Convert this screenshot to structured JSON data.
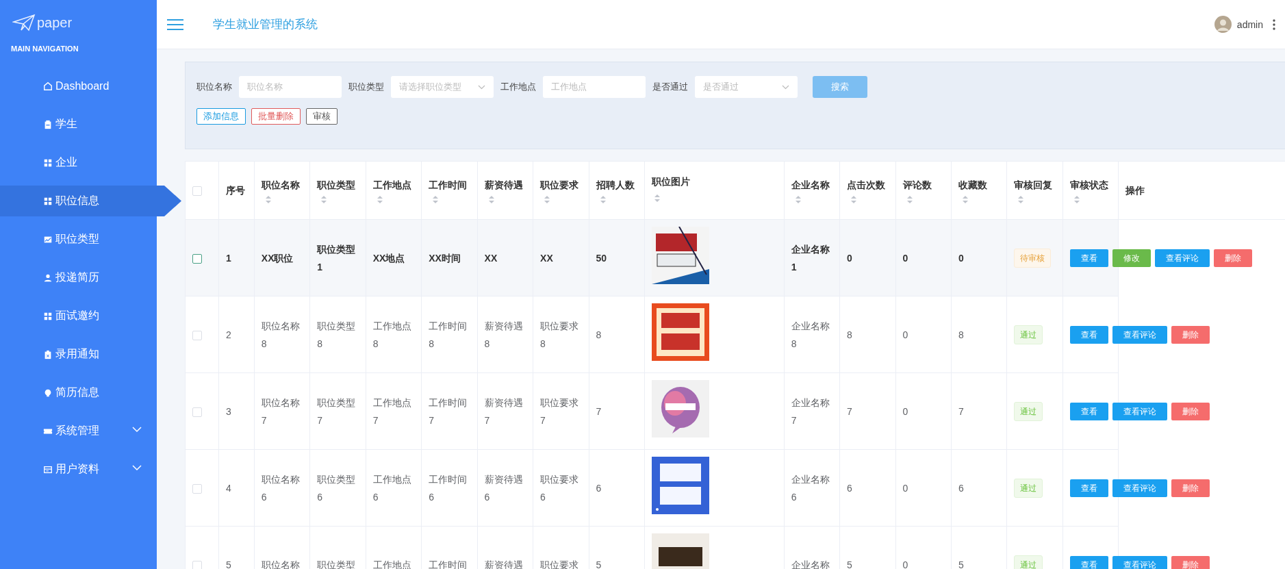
{
  "sidebar": {
    "logo": "paper",
    "section": "MAIN NAVIGATION",
    "items": [
      {
        "label": "Dashboard",
        "selected": false,
        "expandable": false
      },
      {
        "label": "学生",
        "selected": false,
        "expandable": false
      },
      {
        "label": "企业",
        "selected": false,
        "expandable": false
      },
      {
        "label": "职位信息",
        "selected": true,
        "expandable": false
      },
      {
        "label": "职位类型",
        "selected": false,
        "expandable": false
      },
      {
        "label": "投递简历",
        "selected": false,
        "expandable": false
      },
      {
        "label": "面试邀约",
        "selected": false,
        "expandable": false
      },
      {
        "label": "录用通知",
        "selected": false,
        "expandable": false
      },
      {
        "label": "简历信息",
        "selected": false,
        "expandable": false
      },
      {
        "label": "系统管理",
        "selected": false,
        "expandable": true
      },
      {
        "label": "用户资料",
        "selected": false,
        "expandable": true
      }
    ]
  },
  "header": {
    "title": "学生就业管理的系统",
    "user": "admin"
  },
  "filters": {
    "fields": [
      {
        "label": "职位名称",
        "placeholder": "职位名称",
        "kind": "input"
      },
      {
        "label": "职位类型",
        "placeholder": "请选择职位类型",
        "kind": "select"
      },
      {
        "label": "工作地点",
        "placeholder": "工作地点",
        "kind": "input"
      },
      {
        "label": "是否通过",
        "placeholder": "是否通过",
        "kind": "select"
      }
    ],
    "search": "搜索",
    "actions": [
      {
        "label": "添加信息",
        "kind": "add"
      },
      {
        "label": "批量删除",
        "kind": "delete"
      },
      {
        "label": "审核",
        "kind": "audit"
      }
    ]
  },
  "table": {
    "header_checkbox": {
      "checked": false
    },
    "columns": [
      {
        "label": "序号",
        "sortable": false
      },
      {
        "label": "职位名称",
        "sortable": true
      },
      {
        "label": "职位类型",
        "sortable": true
      },
      {
        "label": "工作地点",
        "sortable": true
      },
      {
        "label": "工作时间",
        "sortable": true
      },
      {
        "label": "薪资待遇",
        "sortable": true
      },
      {
        "label": "职位要求",
        "sortable": true
      },
      {
        "label": "招聘人数",
        "sortable": true
      },
      {
        "label": "职位图片",
        "sortable": true
      },
      {
        "label": "企业名称",
        "sortable": true
      },
      {
        "label": "点击次数",
        "sortable": true
      },
      {
        "label": "评论数",
        "sortable": true
      },
      {
        "label": "收藏数",
        "sortable": true
      },
      {
        "label": "审核回复",
        "sortable": true
      },
      {
        "label": "审核状态",
        "sortable": true
      },
      {
        "label": "操作",
        "sortable": false
      }
    ],
    "rows": [
      {
        "checked": false,
        "highlighted": true,
        "cells": [
          "1",
          "XX职位",
          "职位类型1",
          "XX地点",
          "XX时间",
          "XX",
          "XX",
          "50"
        ],
        "image": {
          "kind": "picture"
        },
        "cells2": [
          "企业名称1",
          "0",
          "0",
          "0"
        ],
        "status": {
          "text": "待审核",
          "kind": "pending"
        },
        "buttons": [
          {
            "label": "查看",
            "kind": "view"
          },
          {
            "label": "修改",
            "kind": "edit"
          },
          {
            "label": "查看评论",
            "kind": "view"
          },
          {
            "label": "删除",
            "kind": "delete"
          }
        ]
      },
      {
        "checked": false,
        "highlighted": false,
        "cells": [
          "2",
          "职位名称8",
          "职位类型8",
          "工作地点8",
          "工作时间8",
          "薪资待遇8",
          "职位要求8",
          "8"
        ],
        "image": {
          "kind": "picture"
        },
        "cells2": [
          "企业名称8",
          "8",
          "0",
          "8"
        ],
        "status": {
          "text": "通过",
          "kind": "passed"
        },
        "buttons": [
          {
            "label": "查看",
            "kind": "view"
          },
          {
            "label": "查看评论",
            "kind": "view"
          },
          {
            "label": "删除",
            "kind": "delete"
          }
        ]
      },
      {
        "checked": false,
        "highlighted": false,
        "cells": [
          "3",
          "职位名称7",
          "职位类型7",
          "工作地点7",
          "工作时间7",
          "薪资待遇7",
          "职位要求7",
          "7"
        ],
        "image": {
          "kind": "picture"
        },
        "cells2": [
          "企业名称7",
          "7",
          "0",
          "7"
        ],
        "status": {
          "text": "通过",
          "kind": "passed"
        },
        "buttons": [
          {
            "label": "查看",
            "kind": "view"
          },
          {
            "label": "查看评论",
            "kind": "view"
          },
          {
            "label": "删除",
            "kind": "delete"
          }
        ]
      },
      {
        "checked": false,
        "highlighted": false,
        "cells": [
          "4",
          "职位名称6",
          "职位类型6",
          "工作地点6",
          "工作时间6",
          "薪资待遇6",
          "职位要求6",
          "6"
        ],
        "image": {
          "kind": "picture"
        },
        "cells2": [
          "企业名称6",
          "6",
          "0",
          "6"
        ],
        "status": {
          "text": "通过",
          "kind": "passed"
        },
        "buttons": [
          {
            "label": "查看",
            "kind": "view"
          },
          {
            "label": "查看评论",
            "kind": "view"
          },
          {
            "label": "删除",
            "kind": "delete"
          }
        ]
      },
      {
        "checked": false,
        "highlighted": false,
        "cells": [
          "5",
          "职位名称",
          "职位类型",
          "工作地点",
          "工作时间",
          "薪资待遇",
          "职位要求",
          "5"
        ],
        "image": {
          "kind": "picture"
        },
        "cells2": [
          "企业名称",
          "5",
          "0",
          "5"
        ],
        "status": {
          "text": "通过",
          "kind": "passed"
        },
        "buttons": [
          {
            "label": "查看",
            "kind": "view"
          },
          {
            "label": "查看评论",
            "kind": "view"
          },
          {
            "label": "删除",
            "kind": "delete"
          }
        ]
      }
    ]
  }
}
